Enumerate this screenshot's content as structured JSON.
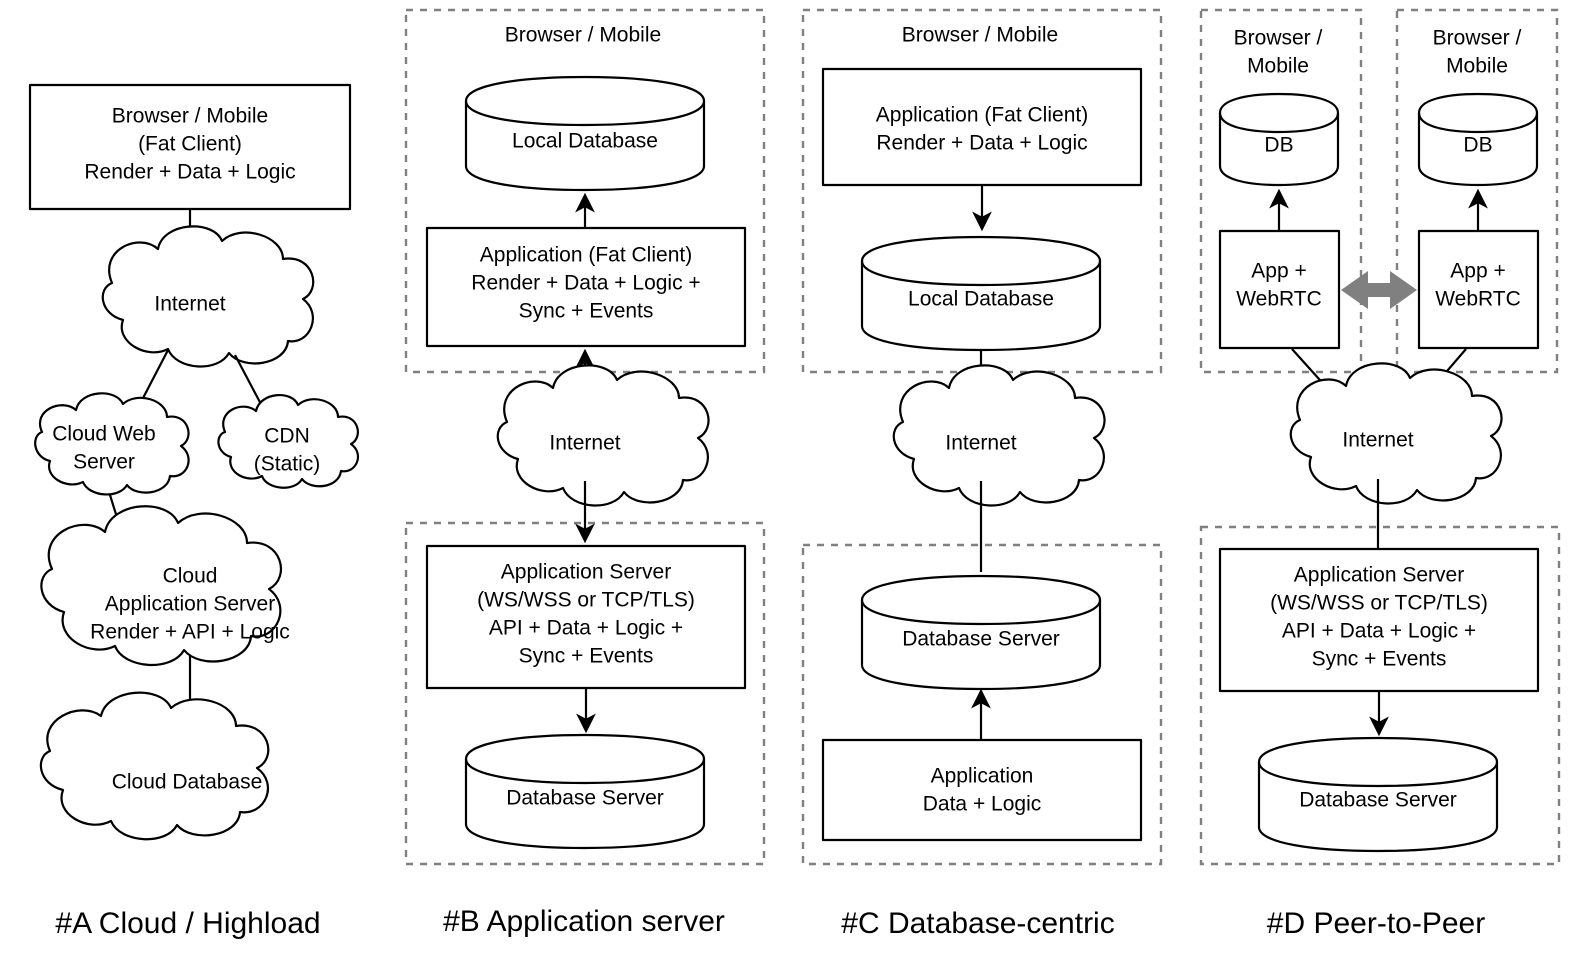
{
  "diagram": {
    "title": "Client-server architecture patterns",
    "background": "#ffffff",
    "stroke_color": "#000000",
    "group_border_color": "#808080",
    "p2p_arrow_color": "#808080"
  },
  "columns": [
    {
      "id": "A",
      "caption": "#A Cloud / Highload",
      "nodes": {
        "client_box": "Browser / Mobile\n(Fat Client)\nRender + Data + Logic",
        "client_box_lines": [
          "Browser / Mobile",
          "(Fat Client)",
          "Render + Data + Logic"
        ],
        "internet_cloud": "Internet",
        "cloud_web_server_lines": [
          "Cloud Web",
          "Server"
        ],
        "cdn_lines": [
          "CDN",
          "(Static)"
        ],
        "cloud_app_server_lines": [
          "Cloud",
          "Application Server",
          "Render + API + Logic"
        ],
        "cloud_database": "Cloud Database"
      }
    },
    {
      "id": "B",
      "caption": "#B Application server",
      "nodes": {
        "client_group_label": "Browser / Mobile",
        "local_database": "Local Database",
        "app_fat_client_lines": [
          "Application (Fat Client)",
          "Render + Data + Logic +",
          "Sync + Events"
        ],
        "internet_cloud": "Internet",
        "app_server_lines": [
          "Application Server",
          "(WS/WSS or TCP/TLS)",
          "API + Data + Logic +",
          "Sync + Events"
        ],
        "database_server": "Database Server"
      }
    },
    {
      "id": "C",
      "caption": "#C Database-centric",
      "nodes": {
        "client_group_label": "Browser / Mobile",
        "app_fat_client_lines": [
          "Application (Fat Client)",
          "Render + Data + Logic"
        ],
        "local_database": "Local Database",
        "internet_cloud": "Internet",
        "database_server": "Database Server",
        "application_lines": [
          "Application",
          "Data + Logic"
        ]
      }
    },
    {
      "id": "D",
      "caption": "#D Peer-to-Peer",
      "nodes": {
        "peer1_group_lines": [
          "Browser /",
          "Mobile"
        ],
        "peer1_db": "DB",
        "peer1_app_lines": [
          "App +",
          "WebRTC"
        ],
        "peer2_group_lines": [
          "Browser /",
          "Mobile"
        ],
        "peer2_db": "DB",
        "peer2_app_lines": [
          "App +",
          "WebRTC"
        ],
        "internet_cloud": "Internet",
        "app_server_lines": [
          "Application Server",
          "(WS/WSS or TCP/TLS)",
          "API + Data + Logic +",
          "Sync + Events"
        ],
        "database_server": "Database Server"
      }
    }
  ],
  "text_nodes": {
    "a_client_l1": "Browser / Mobile",
    "a_client_l2": "(Fat Client)",
    "a_client_l3": "Render + Data + Logic",
    "a_internet": "Internet",
    "a_cws_l1": "Cloud Web",
    "a_cws_l2": "Server",
    "a_cdn_l1": "CDN",
    "a_cdn_l2": "(Static)",
    "a_cas_l1": "Cloud",
    "a_cas_l2": "Application Server",
    "a_cas_l3": "Render + API + Logic",
    "a_cdb": "Cloud Database",
    "a_caption": "#A Cloud / Highload",
    "b_group_top": "Browser / Mobile",
    "b_localdb": "Local Database",
    "b_app_l1": "Application (Fat Client)",
    "b_app_l2": "Render + Data + Logic +",
    "b_app_l3": "Sync + Events",
    "b_internet": "Internet",
    "b_srv_l1": "Application Server",
    "b_srv_l2": "(WS/WSS or TCP/TLS)",
    "b_srv_l3": "API + Data + Logic +",
    "b_srv_l4": "Sync + Events",
    "b_dbsrv": "Database Server",
    "b_caption": "#B Application server",
    "c_group_top": "Browser / Mobile",
    "c_app_l1": "Application (Fat Client)",
    "c_app_l2": "Render + Data + Logic",
    "c_localdb": "Local Database",
    "c_internet": "Internet",
    "c_dbsrv": "Database Server",
    "c_appsrv_l1": "Application",
    "c_appsrv_l2": "Data + Logic",
    "c_caption": "#C Database-centric",
    "d_p1_group_l1": "Browser /",
    "d_p1_group_l2": "Mobile",
    "d_p1_db": "DB",
    "d_p1_app_l1": "App +",
    "d_p1_app_l2": "WebRTC",
    "d_p2_group_l1": "Browser /",
    "d_p2_group_l2": "Mobile",
    "d_p2_db": "DB",
    "d_p2_app_l1": "App +",
    "d_p2_app_l2": "WebRTC",
    "d_internet": "Internet",
    "d_srv_l1": "Application Server",
    "d_srv_l2": "(WS/WSS or TCP/TLS)",
    "d_srv_l3": "API + Data + Logic +",
    "d_srv_l4": "Sync + Events",
    "d_dbsrv": "Database Server",
    "d_caption": "#D Peer-to-Peer"
  }
}
